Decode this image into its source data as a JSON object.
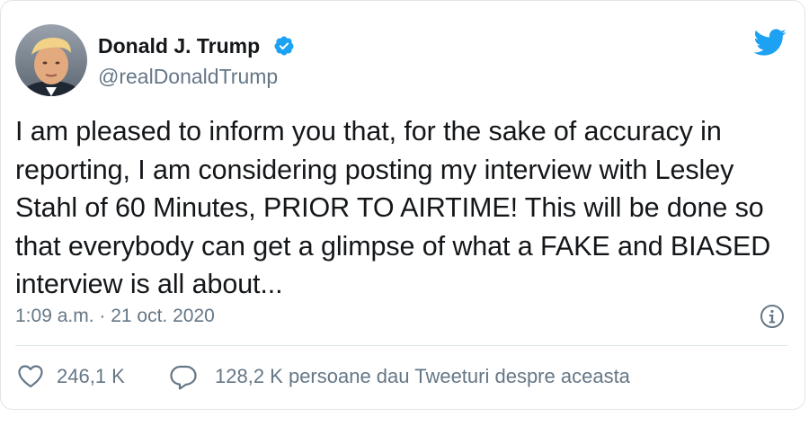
{
  "author": {
    "display_name": "Donald J. Trump",
    "handle": "@realDonaldTrump",
    "verified": true
  },
  "tweet": {
    "lines": [
      "I am pleased to inform you that, for the sake of accuracy in",
      "reporting, I am considering posting my interview with Lesley",
      "Stahl of 60 Minutes, PRIOR TO AIRTIME! This will be done so",
      "that everybody can get a glimpse of what a FAKE and BIASED",
      "interview is all about..."
    ],
    "timestamp": "1:09 a.m. · 21 oct. 2020"
  },
  "stats": {
    "likes": "246,1 K",
    "talking": "128,2 K persoane dau Tweeturi despre aceasta"
  },
  "icons": {
    "brand": "twitter-bird-icon",
    "verified": "verified-badge-icon",
    "info": "info-icon",
    "like": "heart-icon",
    "reply": "speech-bubble-icon"
  },
  "colors": {
    "brand_blue": "#1da1f2",
    "text_primary": "#14171a",
    "text_secondary": "#657786",
    "divider": "#e1e8ed"
  }
}
